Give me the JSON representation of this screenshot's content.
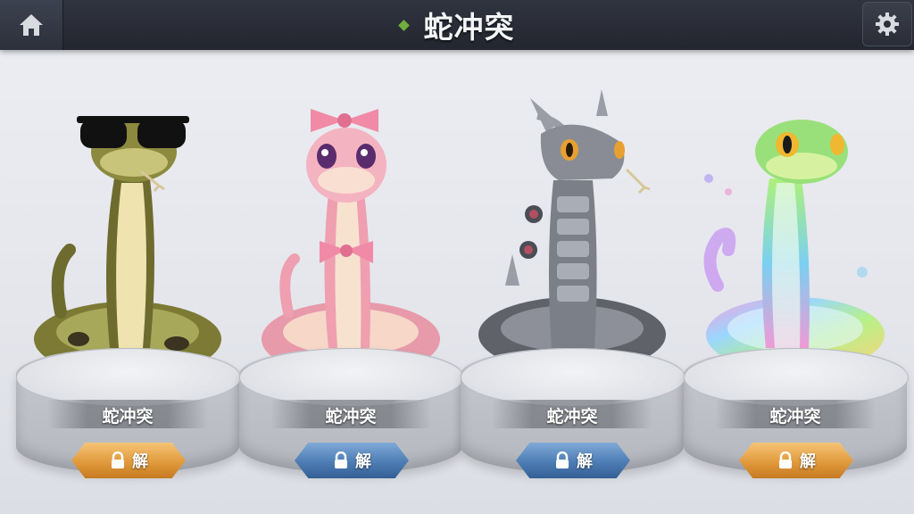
{
  "header": {
    "title": "蛇冲突"
  },
  "colors": {
    "gold_button": "#e19a3c",
    "blue_button": "#4d7db4",
    "accent_diamond": "#6fae3c"
  },
  "cards": [
    {
      "name": "蛇冲突",
      "button_label": "解",
      "button_color": "gold",
      "skin": "python-with-sunglasses"
    },
    {
      "name": "蛇冲突",
      "button_label": "解",
      "button_color": "blue",
      "skin": "pink-snake-with-bows"
    },
    {
      "name": "蛇冲突",
      "button_label": "解",
      "button_color": "blue",
      "skin": "robot-snake"
    },
    {
      "name": "蛇冲突",
      "button_label": "解",
      "button_color": "gold",
      "skin": "rainbow-snake"
    }
  ]
}
